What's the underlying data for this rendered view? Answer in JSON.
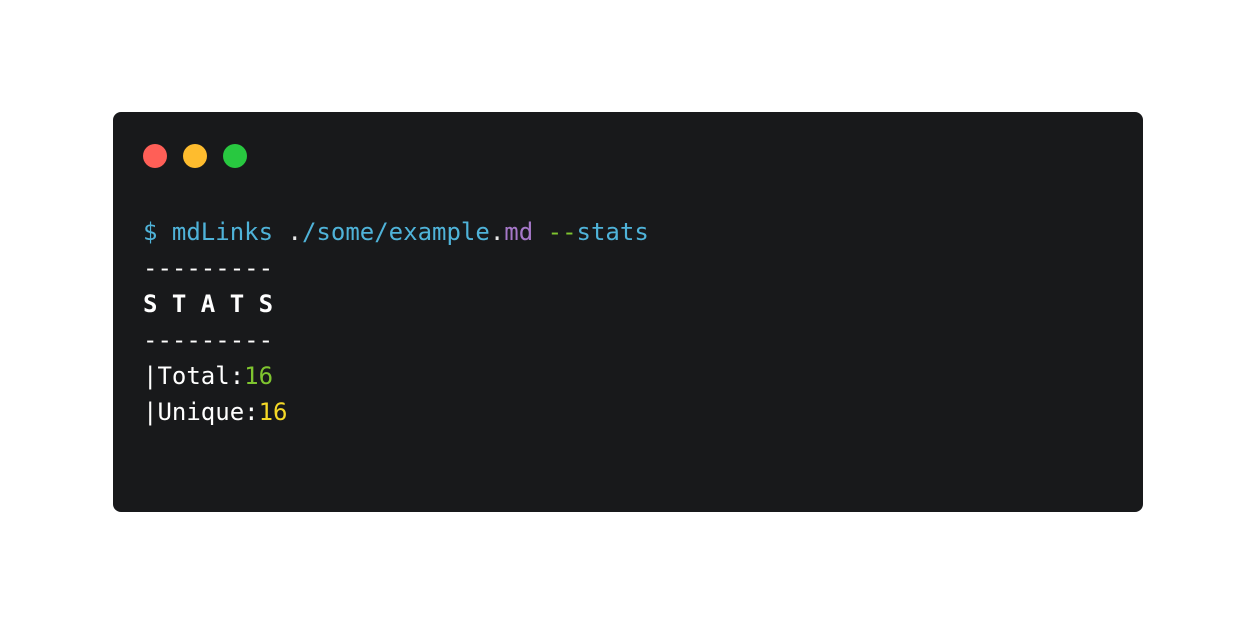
{
  "window": {
    "controls": [
      "close",
      "minimize",
      "maximize"
    ],
    "colors": {
      "background": "#18191b",
      "close": "#ff5f57",
      "minimize": "#febc2e",
      "maximize": "#28c840"
    }
  },
  "terminal": {
    "command": {
      "prompt": "$",
      "program": "mdLinks",
      "path_prefix": ".",
      "path_body": "/some/example",
      "path_dot": ".",
      "path_ext": "md",
      "flag_dashes": "--",
      "flag_name": "stats"
    },
    "separator_top": "---------",
    "heading": "S T A T S",
    "separator_bottom": "---------",
    "stats": {
      "total_label": "|Total:",
      "total_value": "16",
      "unique_label": "|Unique:",
      "unique_value": "16"
    },
    "colors": {
      "command": "#4fb3d9",
      "extension": "#a678c9",
      "flag": "#7fc52f",
      "total_value": "#7fc52f",
      "unique_value": "#f5d927"
    }
  }
}
